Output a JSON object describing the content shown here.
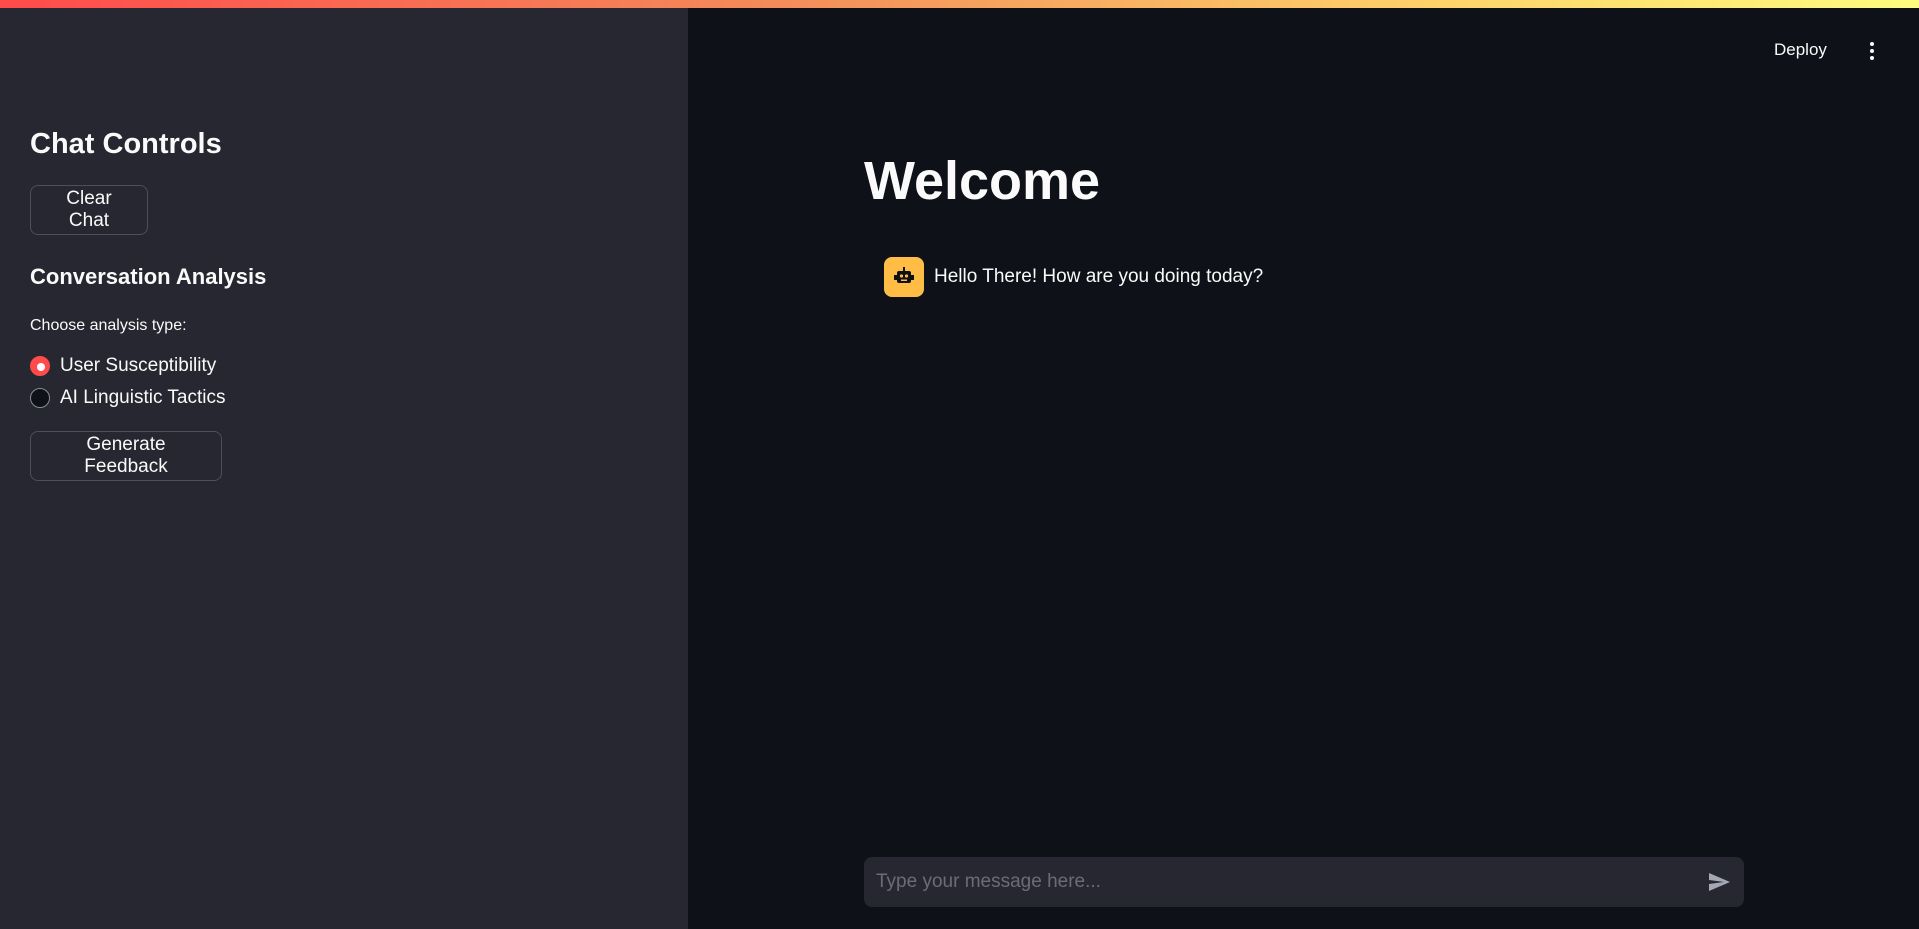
{
  "sidebar": {
    "title": "Chat Controls",
    "clear_button_label": "Clear Chat",
    "section_title": "Conversation Analysis",
    "radio_group_label": "Choose analysis type:",
    "radio_options": [
      {
        "label": "User Susceptibility",
        "checked": true
      },
      {
        "label": "AI Linguistic Tactics",
        "checked": false
      }
    ],
    "generate_button_label": "Generate Feedback"
  },
  "header": {
    "deploy_label": "Deploy",
    "menu_icon": "kebab-menu-icon"
  },
  "main": {
    "title": "Welcome",
    "messages": [
      {
        "role": "assistant",
        "avatar_icon": "robot-icon",
        "text": "Hello There! How are you doing today?"
      }
    ]
  },
  "chat_input": {
    "placeholder": "Type your message here...",
    "value": "",
    "send_icon": "send-icon"
  },
  "colors": {
    "accent": "#ff4b4b",
    "sidebar_bg": "#262730",
    "main_bg": "#0e1117",
    "avatar_bg": "#ffbd45"
  }
}
